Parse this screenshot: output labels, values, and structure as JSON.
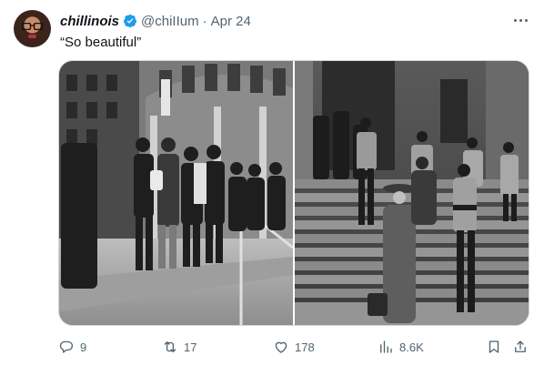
{
  "author": {
    "display_name": "chillinois",
    "handle": "@chiIIum",
    "separator": "·",
    "date": "Apr 24",
    "verified": true,
    "avatar_icon": "profile-avatar"
  },
  "tweet": {
    "text": "“So beautiful”",
    "more_icon": "more-horizontal-icon"
  },
  "media": {
    "images": [
      {
        "description_icon": "photo-protest-steps"
      },
      {
        "description_icon": "photo-historic-steps"
      }
    ]
  },
  "actions": {
    "reply": {
      "icon": "reply-icon",
      "count": "9"
    },
    "retweet": {
      "icon": "retweet-icon",
      "count": "17"
    },
    "like": {
      "icon": "heart-icon",
      "count": "178"
    },
    "views": {
      "icon": "views-chart-icon",
      "count": "8.6K"
    },
    "bookmark": {
      "icon": "bookmark-icon"
    },
    "share": {
      "icon": "share-icon"
    }
  },
  "colors": {
    "text_primary": "#0f1419",
    "text_secondary": "#536471",
    "verified_blue": "#1d9bf0",
    "border": "#cfd9de"
  }
}
